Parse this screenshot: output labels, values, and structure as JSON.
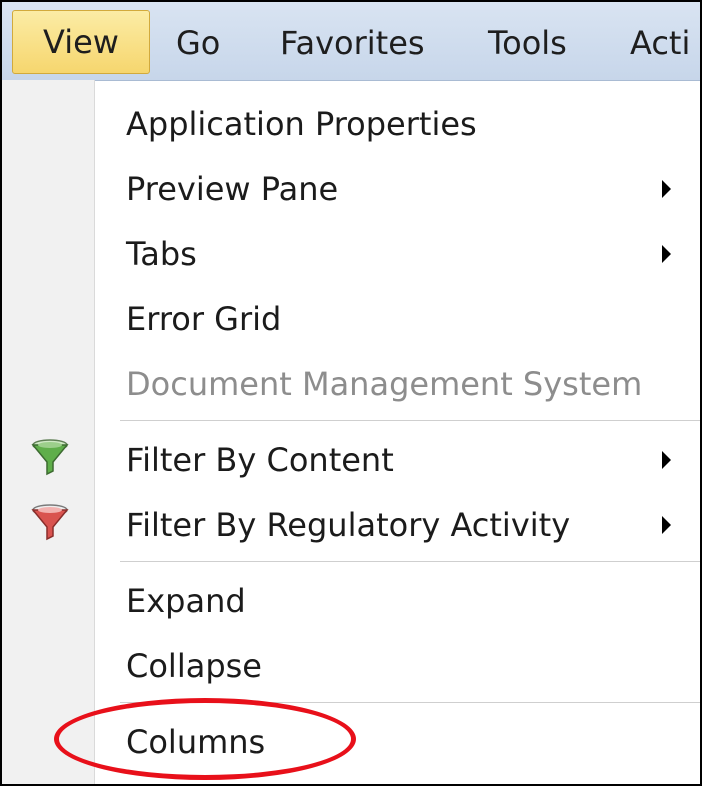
{
  "menubar": {
    "items": [
      {
        "id": "view",
        "label": "View",
        "active": true
      },
      {
        "id": "go",
        "label": "Go"
      },
      {
        "id": "favorites",
        "label": "Favorites"
      },
      {
        "id": "tools",
        "label": "Tools"
      },
      {
        "id": "actions",
        "label": "Acti"
      }
    ]
  },
  "view_menu": {
    "items": [
      {
        "label": "Application Properties",
        "submenu": false,
        "enabled": true
      },
      {
        "label": "Preview Pane",
        "submenu": true,
        "enabled": true
      },
      {
        "label": "Tabs",
        "submenu": true,
        "enabled": true
      },
      {
        "label": "Error Grid",
        "submenu": false,
        "enabled": true
      },
      {
        "label": "Document Management System",
        "submenu": false,
        "enabled": false
      },
      {
        "label": "Filter By Content",
        "submenu": true,
        "enabled": true,
        "icon": "green-funnel-icon"
      },
      {
        "label": "Filter By Regulatory Activity",
        "submenu": true,
        "enabled": true,
        "icon": "red-funnel-icon"
      },
      {
        "label": "Expand",
        "submenu": false,
        "enabled": true
      },
      {
        "label": "Collapse",
        "submenu": false,
        "enabled": true
      },
      {
        "label": "Columns",
        "submenu": false,
        "enabled": true,
        "highlighted": true
      }
    ]
  },
  "colors": {
    "menubar_bg": "#c7d6ea",
    "active_menu_bg": "#f6d66e",
    "disabled_text": "#8d8d8d",
    "highlight_ellipse": "#e8101a",
    "funnel_green": "#5fae4a",
    "funnel_red": "#d9534f"
  }
}
